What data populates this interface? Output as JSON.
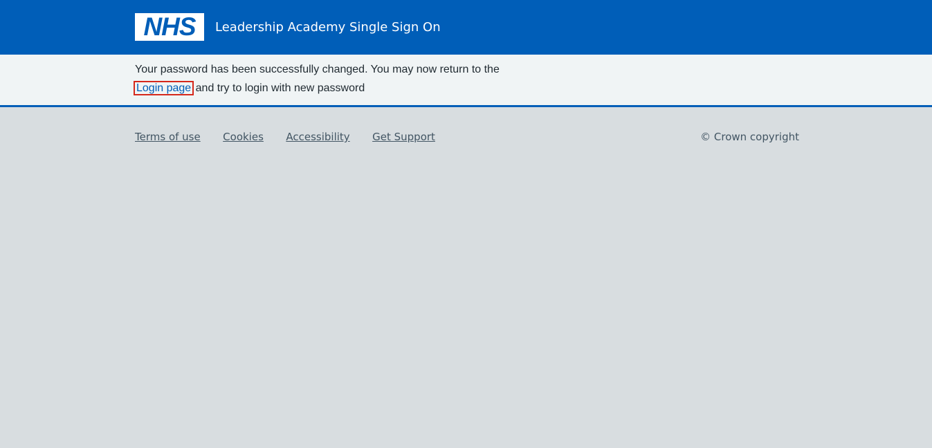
{
  "header": {
    "logo_text": "NHS",
    "service_name": "Leadership Academy Single Sign On"
  },
  "message": {
    "line_before_link": "Your password has been successfully changed. You may now return to the",
    "link_label": "Login page",
    "line_after_link": "and try to login with new password"
  },
  "footer": {
    "links": [
      {
        "label": "Terms of use"
      },
      {
        "label": "Cookies"
      },
      {
        "label": "Accessibility"
      },
      {
        "label": "Get Support"
      }
    ],
    "copyright": "© Crown copyright"
  },
  "colors": {
    "nhs_blue": "#005eb8",
    "page_background": "#d8dde0",
    "message_background": "#f0f4f5",
    "link_highlight_border": "#d5281b"
  }
}
